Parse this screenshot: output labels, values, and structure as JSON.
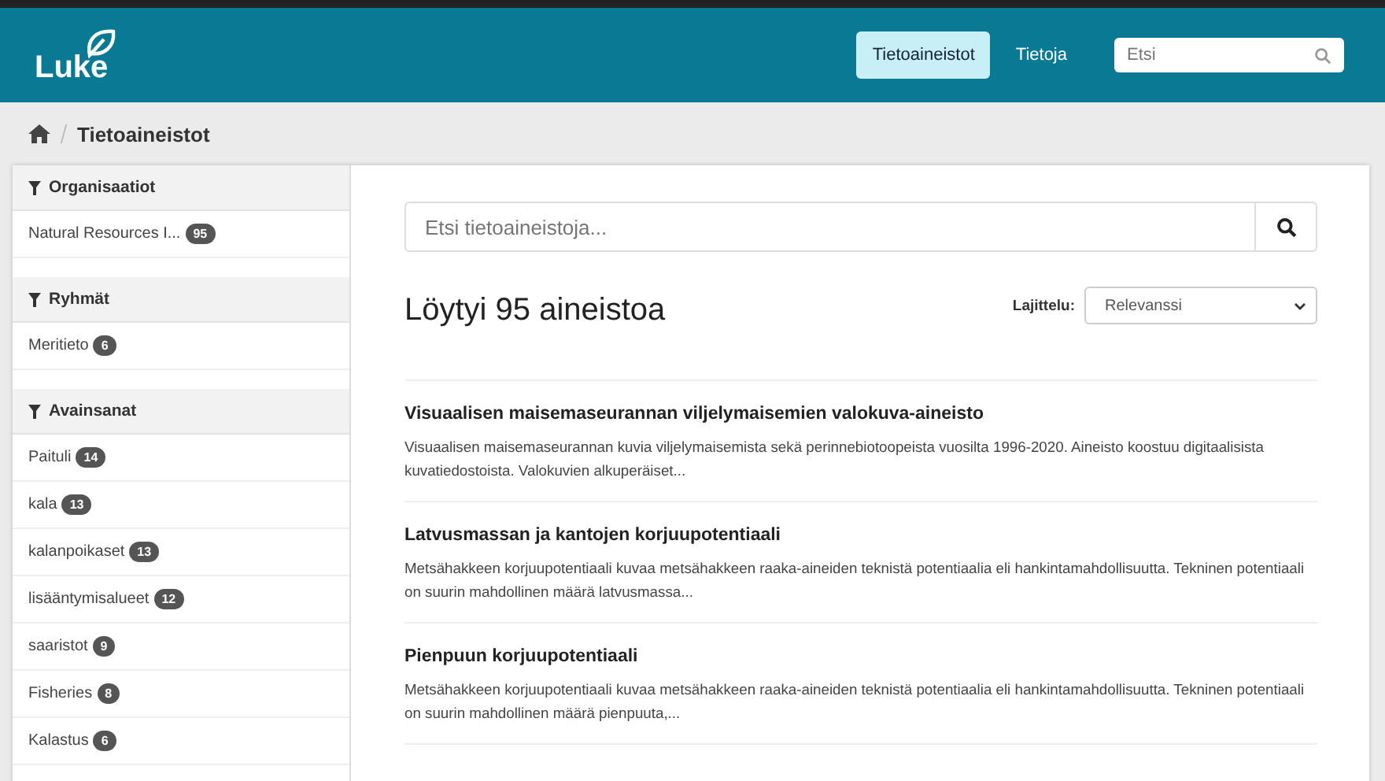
{
  "header": {
    "logo": "Luke",
    "nav": [
      {
        "label": "Tietoaineistot",
        "selected": true
      },
      {
        "label": "Tietoja",
        "selected": false
      }
    ],
    "search": {
      "placeholder": "Etsi"
    }
  },
  "breadcrumb": [
    "Tietoaineistot"
  ],
  "facets": [
    {
      "title": "Organisaatiot",
      "items": [
        {
          "label": "Natural Resources I...",
          "count": "95"
        }
      ]
    },
    {
      "title": "Ryhmät",
      "items": [
        {
          "label": "Meritieto",
          "count": "6"
        }
      ]
    },
    {
      "title": "Avainsanat",
      "items": [
        {
          "label": "Paituli",
          "count": "14"
        },
        {
          "label": "kala",
          "count": "13"
        },
        {
          "label": "kalanpoikaset",
          "count": "13"
        },
        {
          "label": "lisääntymisalueet",
          "count": "12"
        },
        {
          "label": "saaristot",
          "count": "9"
        },
        {
          "label": "Fisheries",
          "count": "8"
        },
        {
          "label": "Kalastus",
          "count": "6"
        }
      ]
    }
  ],
  "search": {
    "placeholder": "Etsi tietoaineistoja..."
  },
  "results_heading": "Löytyi 95 aineistoa",
  "sort": {
    "label": "Lajittelu:",
    "value": "Relevanssi"
  },
  "results": [
    {
      "title": "Visuaalisen maisemaseurannan viljelymaisemien valokuva-aineisto",
      "description": "Visuaalisen maisemaseurannan kuvia viljelymaisemista sekä perinnebiotoopeista vuosilta 1996-2020. Aineisto koostuu digitaalisista kuvatiedostoista. Valokuvien alkuperäiset..."
    },
    {
      "title": "Latvusmassan ja kantojen korjuupotentiaali",
      "description": "Metsähakkeen korjuupotentiaali kuvaa metsähakkeen raaka-aineiden teknistä potentiaalia eli hankintamahdollisuutta. Tekninen potentiaali on suurin mahdollinen määrä latvusmassa..."
    },
    {
      "title": "Pienpuun korjuupotentiaali",
      "description": "Metsähakkeen korjuupotentiaali kuvaa metsähakkeen raaka-aineiden teknistä potentiaalia eli hankintamahdollisuutta. Tekninen potentiaali on suurin mahdollinen määrä pienpuuta,..."
    }
  ]
}
